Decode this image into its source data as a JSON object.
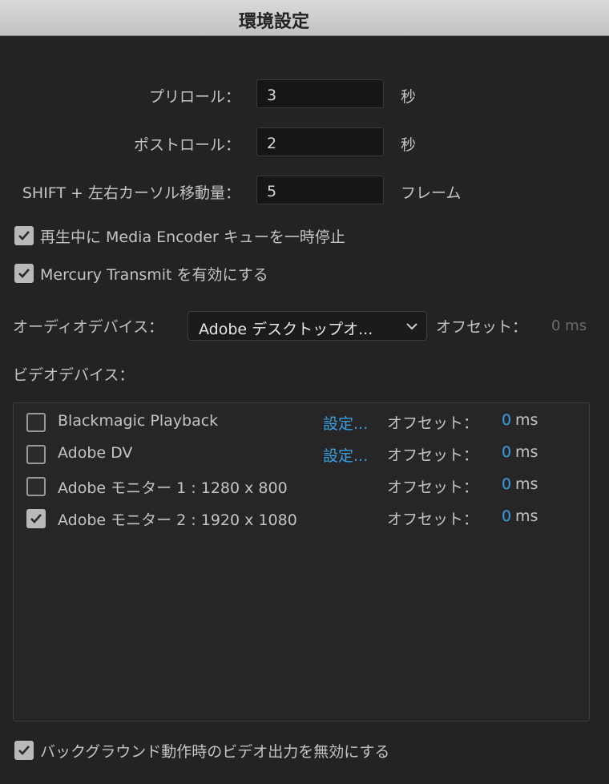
{
  "window": {
    "title": "環境設定"
  },
  "playback": {
    "preroll_label": "プリロール：",
    "preroll_value": "3",
    "preroll_unit": "秒",
    "postroll_label": "ポストロール：",
    "postroll_value": "2",
    "postroll_unit": "秒",
    "shift_label": "SHIFT + 左右カーソル移動量：",
    "shift_value": "5",
    "shift_unit": "フレーム"
  },
  "options": {
    "pause_encoder": {
      "label": "再生中に Media Encoder キューを一時停止",
      "checked": true
    },
    "mercury": {
      "label": "Mercury Transmit を有効にする",
      "checked": true
    }
  },
  "audio": {
    "label": "オーディオデバイス：",
    "selected": "Adobe デスクトップオ...",
    "offset_label": "オフセット：",
    "offset_value": "0 ms"
  },
  "video": {
    "label": "ビデオデバイス：",
    "devices": [
      {
        "name": "Blackmagic Playback",
        "checked": false,
        "settings": "設定...",
        "offset_label": "オフセット：",
        "offset_value": "0",
        "unit": "ms"
      },
      {
        "name": "Adobe DV",
        "checked": false,
        "settings": "設定...",
        "offset_label": "オフセット：",
        "offset_value": "0",
        "unit": "ms"
      },
      {
        "name": "Adobe モニター 1 : 1280 x 800",
        "checked": false,
        "settings": "",
        "offset_label": "オフセット：",
        "offset_value": "0",
        "unit": "ms"
      },
      {
        "name": "Adobe モニター 2 : 1920 x 1080",
        "checked": true,
        "settings": "",
        "offset_label": "オフセット：",
        "offset_value": "0",
        "unit": "ms"
      }
    ]
  },
  "background": {
    "label": "バックグラウンド動作時のビデオ出力を無効にする",
    "checked": true
  }
}
